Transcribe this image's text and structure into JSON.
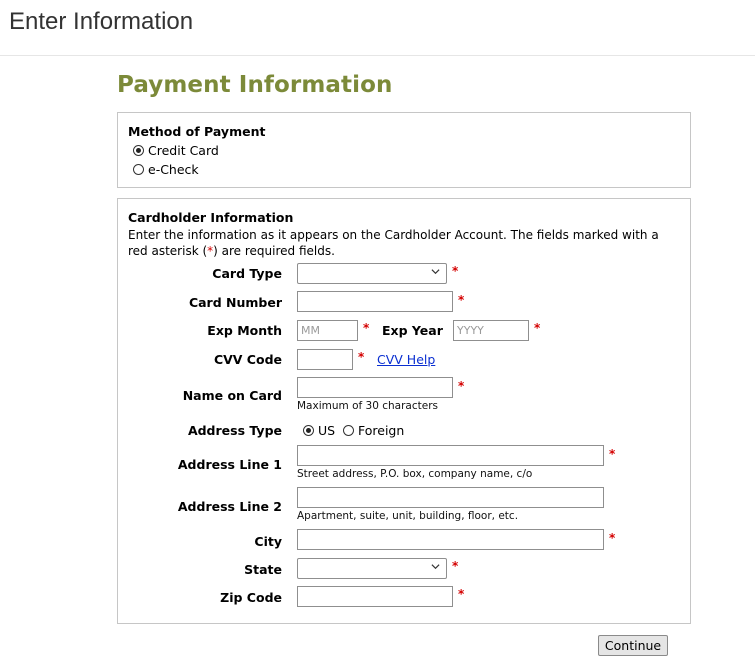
{
  "header": {
    "title": "Enter Information"
  },
  "payment_title": "Payment Information",
  "method": {
    "heading": "Method of Payment",
    "options": [
      {
        "label": "Credit Card",
        "checked": true
      },
      {
        "label": "e-Check",
        "checked": false
      }
    ]
  },
  "cardholder": {
    "heading": "Cardholder Information",
    "desc_before": "Enter the information as it appears on the Cardholder Account. The fields marked with a red asterisk (",
    "desc_star": "*",
    "desc_after": ") are required fields.",
    "required_mark": "*",
    "card_type_label": "Card Type",
    "card_type_value": "",
    "card_number_label": "Card Number",
    "card_number_value": "",
    "exp_month_label": "Exp Month",
    "exp_month_placeholder": "MM",
    "exp_year_label": "Exp Year",
    "exp_year_placeholder": "YYYY",
    "cvv_label": "CVV Code",
    "cvv_value": "",
    "cvv_help": "CVV Help",
    "name_label": "Name on Card",
    "name_value": "",
    "name_hint": "Maximum of 30 characters",
    "address_type_label": "Address Type",
    "address_type_options": [
      {
        "label": "US",
        "checked": true
      },
      {
        "label": "Foreign",
        "checked": false
      }
    ],
    "address1_label": "Address Line 1",
    "address1_value": "",
    "address1_hint": "Street address, P.O. box, company name, c/o",
    "address2_label": "Address Line 2",
    "address2_value": "",
    "address2_hint": "Apartment, suite, unit, building, floor, etc.",
    "city_label": "City",
    "city_value": "",
    "state_label": "State",
    "state_value": "",
    "zip_label": "Zip Code",
    "zip_value": ""
  },
  "continue_label": "Continue",
  "colors": {
    "title_green": "#7c8a39",
    "required_red": "#d40000",
    "link_blue": "#0a2fd1"
  }
}
